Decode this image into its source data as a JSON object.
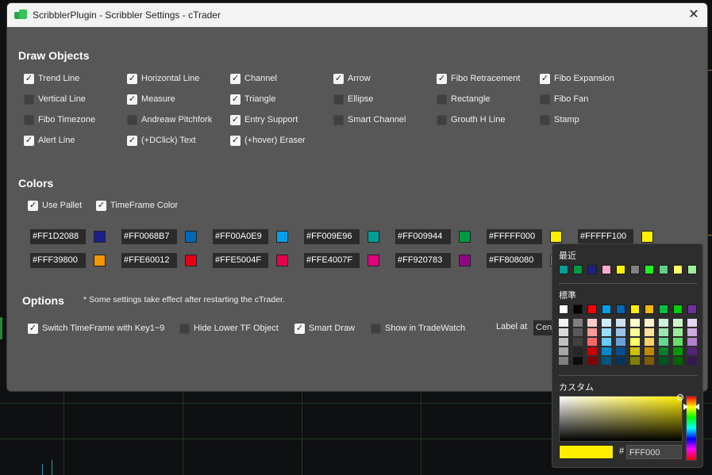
{
  "window": {
    "title": "ScribblerPlugin - Scribbler Settings - cTrader",
    "close_glyph": "✕"
  },
  "draw_objects": {
    "title": "Draw Objects",
    "items": [
      {
        "label": "Trend Line",
        "checked": true
      },
      {
        "label": "Horizontal Line",
        "checked": true
      },
      {
        "label": "Channel",
        "checked": true
      },
      {
        "label": "Arrow",
        "checked": true
      },
      {
        "label": "Fibo Retracement",
        "checked": true
      },
      {
        "label": "Fibo Expansion",
        "checked": true
      },
      {
        "label": "Vertical Line",
        "checked": false
      },
      {
        "label": "Measure",
        "checked": true
      },
      {
        "label": "Triangle",
        "checked": true
      },
      {
        "label": "Ellipse",
        "checked": false
      },
      {
        "label": "Rectangle",
        "checked": false
      },
      {
        "label": "Fibo Fan",
        "checked": false
      },
      {
        "label": "Fibo Timezone",
        "checked": false
      },
      {
        "label": "Andreaw Pitchfork",
        "checked": false
      },
      {
        "label": "Entry Support",
        "checked": true
      },
      {
        "label": "Smart Channel",
        "checked": false
      },
      {
        "label": "Grouth H Line",
        "checked": false
      },
      {
        "label": "Stamp",
        "checked": false
      },
      {
        "label": "Alert Line",
        "checked": true
      },
      {
        "label": "(+DClick) Text",
        "checked": true
      },
      {
        "label": "(+hover) Eraser",
        "checked": true
      }
    ]
  },
  "colors": {
    "title": "Colors",
    "use_pallet": {
      "label": "Use Pallet",
      "checked": true
    },
    "timeframe_color": {
      "label": "TimeFrame Color",
      "checked": true
    },
    "row1": [
      {
        "hex": "#FF1D2088",
        "color": "#1d2088"
      },
      {
        "hex": "#FF0068B7",
        "color": "#0068b7"
      },
      {
        "hex": "#FF00A0E9",
        "color": "#00a0e9"
      },
      {
        "hex": "#FF009E96",
        "color": "#009e96"
      },
      {
        "hex": "#FF009944",
        "color": "#009944"
      },
      {
        "hex": "#FFFFF000",
        "color": "#fff000"
      },
      {
        "hex": "#FFFFF100",
        "color": "#fff100"
      }
    ],
    "row2": [
      {
        "hex": "#FFF39800",
        "color": "#f39800"
      },
      {
        "hex": "#FFE60012",
        "color": "#e60012"
      },
      {
        "hex": "#FFE5004F",
        "color": "#e5004f"
      },
      {
        "hex": "#FFE4007F",
        "color": "#e4007f"
      },
      {
        "hex": "#FF920783",
        "color": "#920783"
      },
      {
        "hex": "#FF808080",
        "color": "#808080"
      }
    ]
  },
  "options": {
    "title": "Options",
    "note": "* Some settings take effect after restarting the cTrader.",
    "items": [
      {
        "label": "Switch TimeFrame with Key1~9",
        "checked": true
      },
      {
        "label": "Hide Lower TF Object",
        "checked": false
      },
      {
        "label": "Smart Draw",
        "checked": true
      },
      {
        "label": "Show in TradeWatch",
        "checked": false
      }
    ],
    "label_at": "Label at",
    "label_at_value": "Cent"
  },
  "picker": {
    "recent_label": "最近",
    "recent": [
      "#009e96",
      "#009944",
      "#1d2088",
      "#ffaacc",
      "#fff100",
      "#808080",
      "#22ee22",
      "#66cc88",
      "#ffff66",
      "#99ee99"
    ],
    "standard_label": "標準",
    "standard": [
      "#ffffff",
      "#000000",
      "#ff0000",
      "#00a0e9",
      "#0068b7",
      "#fff000",
      "#f3b800",
      "#00c040",
      "#00d000",
      "#7030a0"
    ],
    "shades": [
      [
        "#f2f2f2",
        "#d9d9d9",
        "#bfbfbf",
        "#a6a6a6",
        "#808080"
      ],
      [
        "#808080",
        "#595959",
        "#404040",
        "#262626",
        "#0d0d0d"
      ],
      [
        "#ffcccc",
        "#ff9999",
        "#ff6666",
        "#cc0000",
        "#800000"
      ],
      [
        "#cceeff",
        "#99ddff",
        "#66ccff",
        "#0088cc",
        "#005580"
      ],
      [
        "#cce0f0",
        "#99c2e6",
        "#66a3d9",
        "#004f8c",
        "#00345c"
      ],
      [
        "#ffffcc",
        "#ffff99",
        "#ffff66",
        "#ccc000",
        "#808000"
      ],
      [
        "#fff0cc",
        "#ffe199",
        "#ffd166",
        "#c08a00",
        "#805c00"
      ],
      [
        "#ccf2d9",
        "#99e6b3",
        "#66d98c",
        "#00802b",
        "#00561d"
      ],
      [
        "#ccf5cc",
        "#99eb99",
        "#66e066",
        "#009900",
        "#006600"
      ],
      [
        "#e5d5f0",
        "#cbabe0",
        "#b180d1",
        "#522478",
        "#361850"
      ]
    ],
    "custom_label": "カスタム",
    "current_color": "#ffee00",
    "hash": "#",
    "hex_value": "FFF000"
  }
}
